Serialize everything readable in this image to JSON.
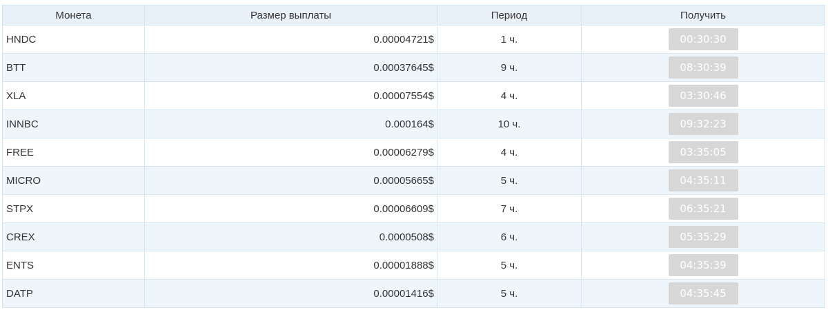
{
  "table": {
    "headers": {
      "coin": "Монета",
      "amount": "Размер выплаты",
      "period": "Период",
      "get": "Получить"
    },
    "rows": [
      {
        "coin": "HNDC",
        "amount": "0.00004721$",
        "period": "1 ч.",
        "timer": "00:30:30"
      },
      {
        "coin": "BTT",
        "amount": "0.00037645$",
        "period": "9 ч.",
        "timer": "08:30:39"
      },
      {
        "coin": "XLA",
        "amount": "0.00007554$",
        "period": "4 ч.",
        "timer": "03:30:46"
      },
      {
        "coin": "INNBC",
        "amount": "0.000164$",
        "period": "10 ч.",
        "timer": "09:32:23"
      },
      {
        "coin": "FREE",
        "amount": "0.00006279$",
        "period": "4 ч.",
        "timer": "03:35:05"
      },
      {
        "coin": "MICRO",
        "amount": "0.00005665$",
        "period": "5 ч.",
        "timer": "04:35:11"
      },
      {
        "coin": "STPX",
        "amount": "0.00006609$",
        "period": "7 ч.",
        "timer": "06:35:21"
      },
      {
        "coin": "CREX",
        "amount": "0.0000508$",
        "period": "6 ч.",
        "timer": "05:35:29"
      },
      {
        "coin": "ENTS",
        "amount": "0.00001888$",
        "period": "5 ч.",
        "timer": "04:35:39"
      },
      {
        "coin": "DATP",
        "amount": "0.00001416$",
        "period": "5 ч.",
        "timer": "04:35:45"
      }
    ]
  },
  "colors": {
    "header_bg": "#e9f1f8",
    "row_alt_bg": "#eef5fb",
    "border": "#d4e6f2",
    "button_disabled_bg": "#d7d7d7",
    "button_text": "#ffffff"
  }
}
